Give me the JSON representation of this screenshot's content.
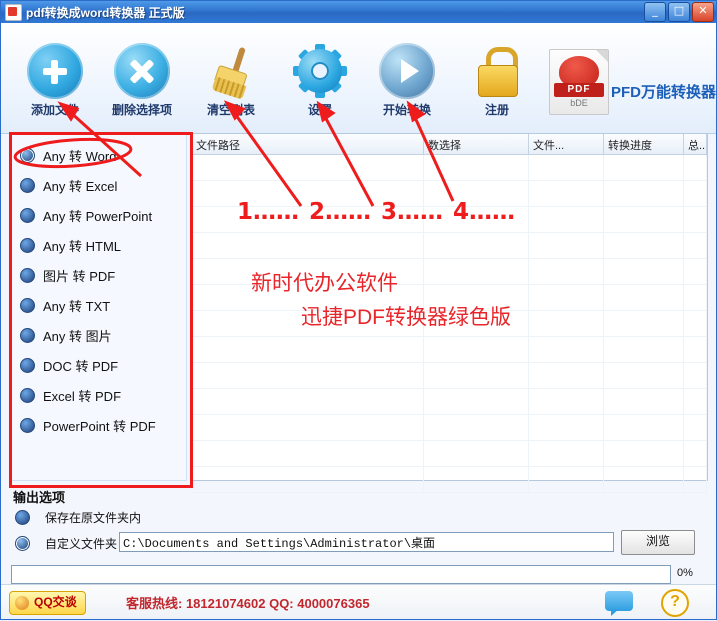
{
  "window": {
    "title": "pdf转换成word转换器  正式版",
    "icon": "app-icon",
    "minimize": "_",
    "maximize": "□",
    "close": "✕"
  },
  "toolbar": {
    "items": [
      {
        "label": "添加文件",
        "icon": "add-circle-icon"
      },
      {
        "label": "删除选择项",
        "icon": "delete-circle-icon"
      },
      {
        "label": "清空列表",
        "icon": "broom-icon"
      },
      {
        "label": "设置",
        "icon": "gear-icon"
      },
      {
        "label": "开始转换",
        "icon": "play-icon"
      },
      {
        "label": "注册",
        "icon": "lock-icon"
      }
    ],
    "logo": {
      "badge": "PDF",
      "sub": "bDE",
      "text": "PFD万能转换器"
    }
  },
  "formats": {
    "selected_index": 0,
    "items": [
      "Any 转 Word",
      "Any 转 Excel",
      "Any 转 PowerPoint",
      "Any 转 HTML",
      "图片 转 PDF",
      "Any 转 TXT",
      "Any 转 图片",
      "DOC 转 PDF",
      "Excel 转 PDF",
      "PowerPoint 转 PDF"
    ]
  },
  "filelist": {
    "columns": [
      "文件路径",
      "数选择",
      "文件...",
      "转换进度",
      "总..."
    ],
    "rows": []
  },
  "output": {
    "title": "输出选项",
    "option_same_folder": "保存在原文件夹内",
    "option_custom_folder": "自定义文件夹",
    "selected": "custom",
    "path_value": "C:\\Documents and Settings\\Administrator\\桌面",
    "browse_label": "浏览",
    "progress_percent": "0%",
    "progress_value": 0
  },
  "status": {
    "qq_button": "QQ交谈",
    "hotline": "客服热线: 18121074602 QQ:  4000076365",
    "chat_icon": "chat-icon",
    "help_icon": "help-icon"
  },
  "annotations": {
    "numbers": [
      "1……",
      "2……",
      "3……",
      "4……"
    ],
    "line1": "新时代办公软件",
    "line2": "迅捷PDF转换器绿色版"
  },
  "colors": {
    "accent": "#1b5fb8",
    "annotation_red": "#ee1c1c",
    "annotation_text": "#e8262a",
    "titlebar": "#2f74cf"
  }
}
